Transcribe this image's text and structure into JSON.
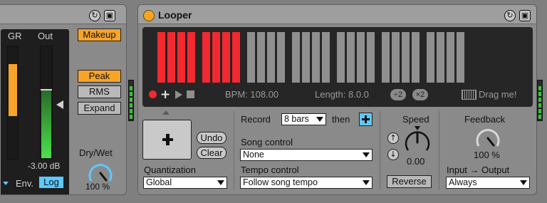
{
  "compressor": {
    "gr_label": "GR",
    "out_label": "Out",
    "makeup_label": "Makeup",
    "peak_label": "Peak",
    "rms_label": "RMS",
    "expand_label": "Expand",
    "out_value": "-3.00 dB",
    "drywet_label": "Dry/Wet",
    "drywet_value": "100 %",
    "env_label": "Env.",
    "log_label": "Log",
    "accent": "#f8a42a",
    "meter_green": "#3fbf3f"
  },
  "looper": {
    "title": "Looper",
    "bars_total": 28,
    "bars_red": 8,
    "bpm": "BPM: 108.00",
    "length": "Length: 8.0.0",
    "half_label": "÷2",
    "double_label": "×2",
    "drag_label": "Drag me!",
    "undo_label": "Undo",
    "clear_label": "Clear",
    "quantization_label": "Quantization",
    "quantization_value": "Global",
    "record_label": "Record",
    "record_value": "8 bars",
    "then_label": "then",
    "song_control_label": "Song control",
    "song_control_value": "None",
    "tempo_control_label": "Tempo control",
    "tempo_control_value": "Follow song tempo",
    "speed_label": "Speed",
    "speed_value": "0.00",
    "reverse_label": "Reverse",
    "feedback_label": "Feedback",
    "feedback_value": "100 %",
    "io_label": "Input → Output",
    "io_value": "Always",
    "bar_red_color": "#f22930",
    "bar_gray_color": "#8f8f8f"
  }
}
